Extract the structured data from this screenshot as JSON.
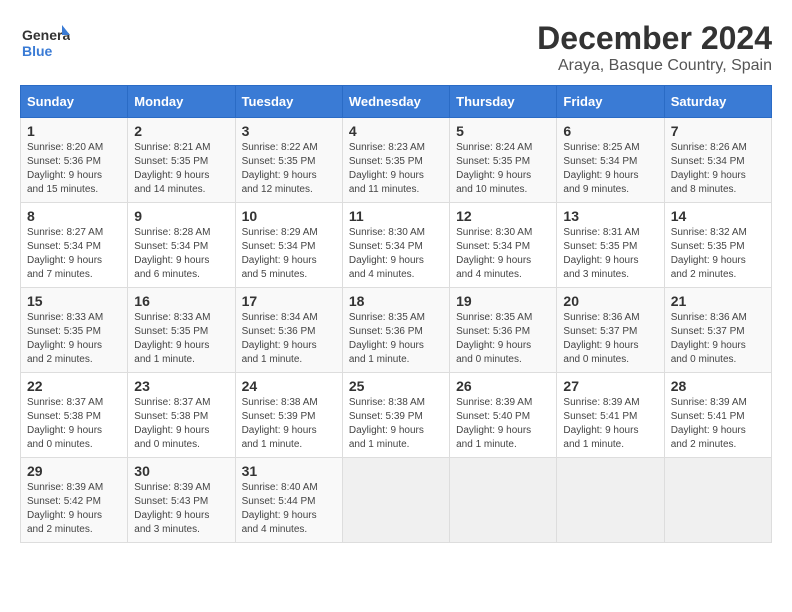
{
  "logo": {
    "text_general": "General",
    "text_blue": "Blue"
  },
  "title": "December 2024",
  "location": "Araya, Basque Country, Spain",
  "days_of_week": [
    "Sunday",
    "Monday",
    "Tuesday",
    "Wednesday",
    "Thursday",
    "Friday",
    "Saturday"
  ],
  "weeks": [
    [
      {
        "day": 1,
        "sunrise": "8:20 AM",
        "sunset": "5:36 PM",
        "daylight": "9 hours and 15 minutes."
      },
      {
        "day": 2,
        "sunrise": "8:21 AM",
        "sunset": "5:35 PM",
        "daylight": "9 hours and 14 minutes."
      },
      {
        "day": 3,
        "sunrise": "8:22 AM",
        "sunset": "5:35 PM",
        "daylight": "9 hours and 12 minutes."
      },
      {
        "day": 4,
        "sunrise": "8:23 AM",
        "sunset": "5:35 PM",
        "daylight": "9 hours and 11 minutes."
      },
      {
        "day": 5,
        "sunrise": "8:24 AM",
        "sunset": "5:35 PM",
        "daylight": "9 hours and 10 minutes."
      },
      {
        "day": 6,
        "sunrise": "8:25 AM",
        "sunset": "5:34 PM",
        "daylight": "9 hours and 9 minutes."
      },
      {
        "day": 7,
        "sunrise": "8:26 AM",
        "sunset": "5:34 PM",
        "daylight": "9 hours and 8 minutes."
      }
    ],
    [
      {
        "day": 8,
        "sunrise": "8:27 AM",
        "sunset": "5:34 PM",
        "daylight": "9 hours and 7 minutes."
      },
      {
        "day": 9,
        "sunrise": "8:28 AM",
        "sunset": "5:34 PM",
        "daylight": "9 hours and 6 minutes."
      },
      {
        "day": 10,
        "sunrise": "8:29 AM",
        "sunset": "5:34 PM",
        "daylight": "9 hours and 5 minutes."
      },
      {
        "day": 11,
        "sunrise": "8:30 AM",
        "sunset": "5:34 PM",
        "daylight": "9 hours and 4 minutes."
      },
      {
        "day": 12,
        "sunrise": "8:30 AM",
        "sunset": "5:34 PM",
        "daylight": "9 hours and 4 minutes."
      },
      {
        "day": 13,
        "sunrise": "8:31 AM",
        "sunset": "5:35 PM",
        "daylight": "9 hours and 3 minutes."
      },
      {
        "day": 14,
        "sunrise": "8:32 AM",
        "sunset": "5:35 PM",
        "daylight": "9 hours and 2 minutes."
      }
    ],
    [
      {
        "day": 15,
        "sunrise": "8:33 AM",
        "sunset": "5:35 PM",
        "daylight": "9 hours and 2 minutes."
      },
      {
        "day": 16,
        "sunrise": "8:33 AM",
        "sunset": "5:35 PM",
        "daylight": "9 hours and 1 minute."
      },
      {
        "day": 17,
        "sunrise": "8:34 AM",
        "sunset": "5:36 PM",
        "daylight": "9 hours and 1 minute."
      },
      {
        "day": 18,
        "sunrise": "8:35 AM",
        "sunset": "5:36 PM",
        "daylight": "9 hours and 1 minute."
      },
      {
        "day": 19,
        "sunrise": "8:35 AM",
        "sunset": "5:36 PM",
        "daylight": "9 hours and 0 minutes."
      },
      {
        "day": 20,
        "sunrise": "8:36 AM",
        "sunset": "5:37 PM",
        "daylight": "9 hours and 0 minutes."
      },
      {
        "day": 21,
        "sunrise": "8:36 AM",
        "sunset": "5:37 PM",
        "daylight": "9 hours and 0 minutes."
      }
    ],
    [
      {
        "day": 22,
        "sunrise": "8:37 AM",
        "sunset": "5:38 PM",
        "daylight": "9 hours and 0 minutes."
      },
      {
        "day": 23,
        "sunrise": "8:37 AM",
        "sunset": "5:38 PM",
        "daylight": "9 hours and 0 minutes."
      },
      {
        "day": 24,
        "sunrise": "8:38 AM",
        "sunset": "5:39 PM",
        "daylight": "9 hours and 1 minute."
      },
      {
        "day": 25,
        "sunrise": "8:38 AM",
        "sunset": "5:39 PM",
        "daylight": "9 hours and 1 minute."
      },
      {
        "day": 26,
        "sunrise": "8:39 AM",
        "sunset": "5:40 PM",
        "daylight": "9 hours and 1 minute."
      },
      {
        "day": 27,
        "sunrise": "8:39 AM",
        "sunset": "5:41 PM",
        "daylight": "9 hours and 1 minute."
      },
      {
        "day": 28,
        "sunrise": "8:39 AM",
        "sunset": "5:41 PM",
        "daylight": "9 hours and 2 minutes."
      }
    ],
    [
      {
        "day": 29,
        "sunrise": "8:39 AM",
        "sunset": "5:42 PM",
        "daylight": "9 hours and 2 minutes."
      },
      {
        "day": 30,
        "sunrise": "8:39 AM",
        "sunset": "5:43 PM",
        "daylight": "9 hours and 3 minutes."
      },
      {
        "day": 31,
        "sunrise": "8:40 AM",
        "sunset": "5:44 PM",
        "daylight": "9 hours and 4 minutes."
      },
      null,
      null,
      null,
      null
    ]
  ]
}
